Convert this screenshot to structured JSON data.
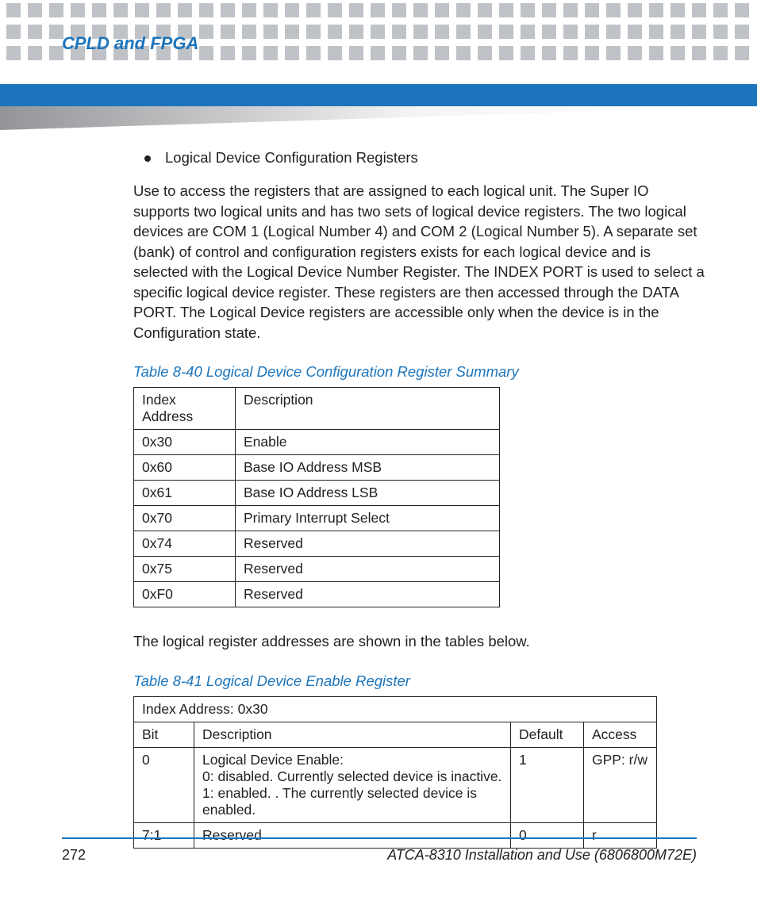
{
  "header": {
    "chapter_title": "CPLD and FPGA"
  },
  "bullet": {
    "text": "Logical Device Configuration Registers"
  },
  "paragraph1": "Use to access the registers that are assigned to each logical unit. The Super IO supports two logical units and has two sets of logical device registers. The two logical devices are COM 1 (Logical Number 4) and COM 2 (Logical Number 5). A separate set (bank) of control and configuration registers exists for each logical device and is selected with the Logical Device Number Register. The INDEX PORT is used to select a specific logical device register. These registers are then accessed through the DATA PORT. The Logical Device registers are accessible only when the device is in the Configuration state.",
  "table40": {
    "caption": "Table 8-40 Logical Device Configuration Register Summary",
    "headers": [
      "Index Address",
      "Description"
    ],
    "rows": [
      [
        "0x30",
        "Enable"
      ],
      [
        "0x60",
        "Base IO Address MSB"
      ],
      [
        "0x61",
        "Base IO Address LSB"
      ],
      [
        "0x70",
        "Primary Interrupt Select"
      ],
      [
        "0x74",
        "Reserved"
      ],
      [
        "0x75",
        "Reserved"
      ],
      [
        "0xF0",
        "Reserved"
      ]
    ]
  },
  "paragraph2": "The logical register addresses are shown in the tables below.",
  "table41": {
    "caption": "Table 8-41 Logical Device Enable Register",
    "title_row": "Index Address: 0x30",
    "headers": [
      "Bit",
      "Description",
      "Default",
      "Access"
    ],
    "rows": [
      [
        "0",
        "Logical Device Enable:\n0: disabled. Currently selected device is inactive.\n1: enabled. . The currently selected device is enabled.",
        "1",
        "GPP: r/w"
      ],
      [
        "7:1",
        "Reserved",
        "0",
        "r"
      ]
    ]
  },
  "footer": {
    "page_number": "272",
    "doc_title": "ATCA-8310 Installation and Use (6806800M72E)"
  }
}
